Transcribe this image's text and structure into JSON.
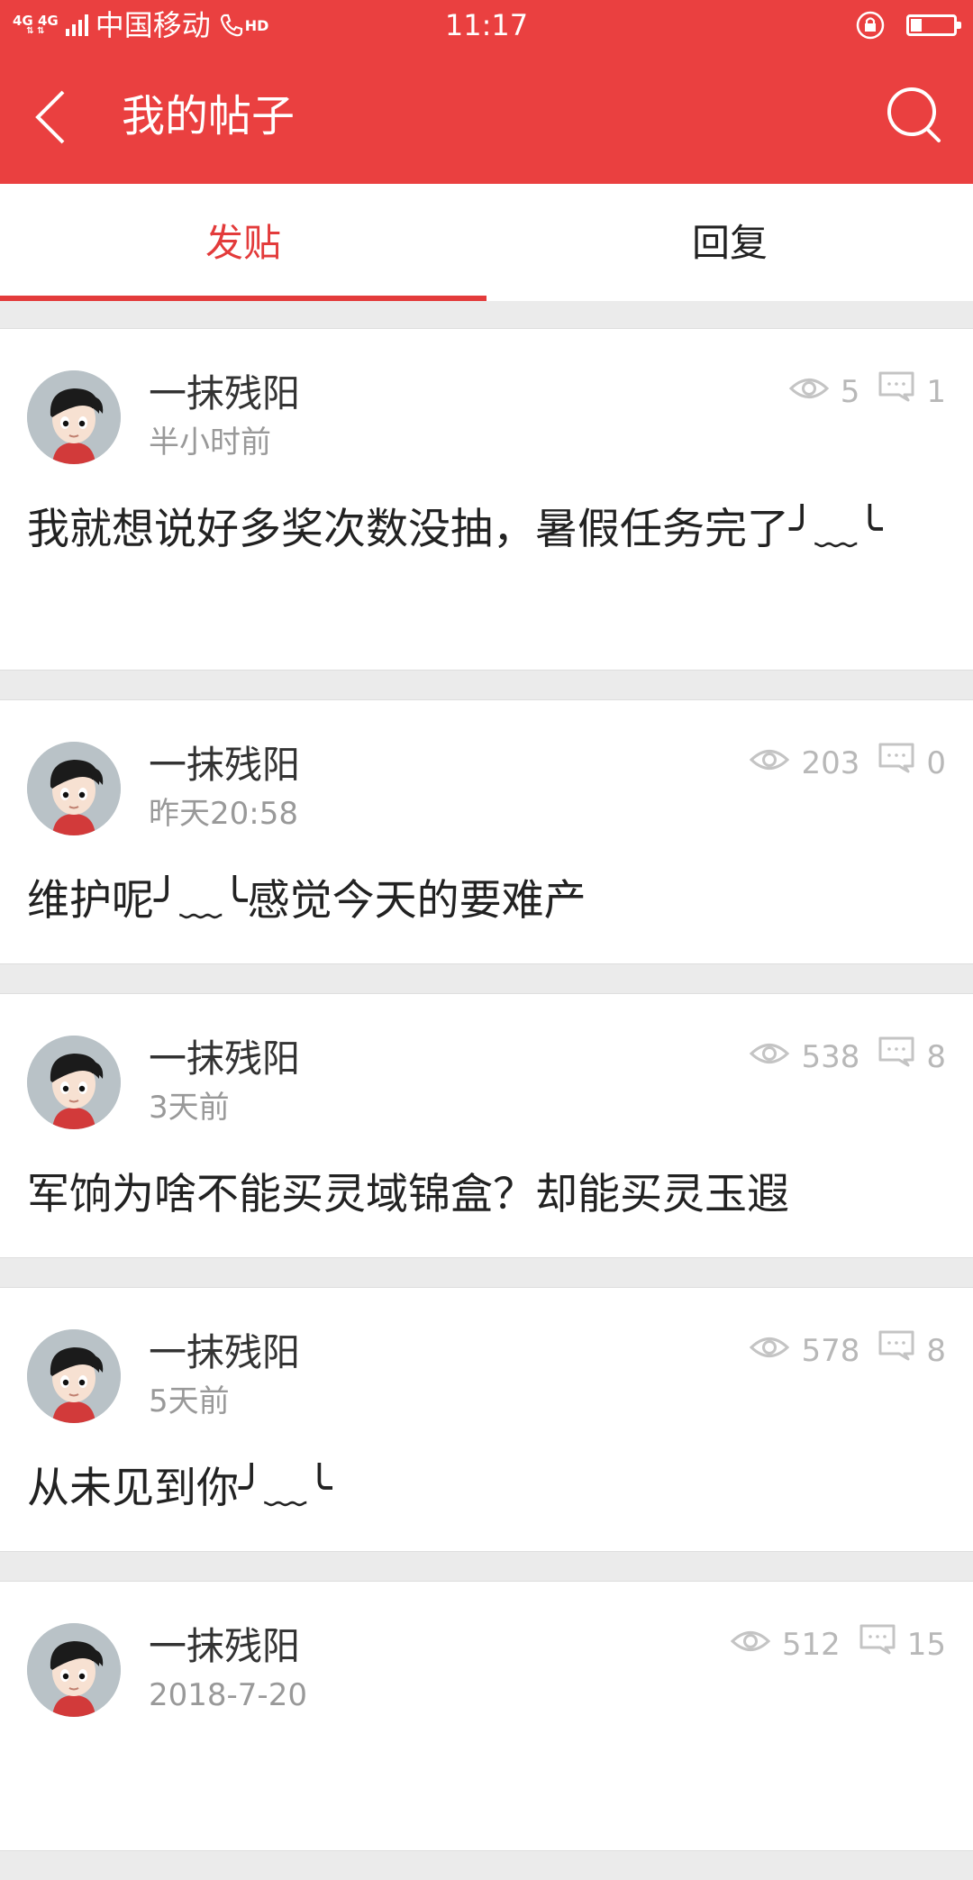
{
  "status_bar": {
    "network": "4G 4G",
    "carrier": "中国移动",
    "hd": "HD",
    "time": "11:17"
  },
  "header": {
    "title": "我的帖子"
  },
  "tabs": {
    "post": "发贴",
    "reply": "回复"
  },
  "posts": [
    {
      "author": "一抹残阳",
      "time": "半小时前",
      "views": "5",
      "comments": "1",
      "content": "我就想说好多奖次数没抽，暑假任务完了╯﹏╰"
    },
    {
      "author": "一抹残阳",
      "time": "昨天20:58",
      "views": "203",
      "comments": "0",
      "content": "维护呢╯﹏╰感觉今天的要难产"
    },
    {
      "author": "一抹残阳",
      "time": "3天前",
      "views": "538",
      "comments": "8",
      "content": "军饷为啥不能买灵域锦盒？却能买灵玉遐"
    },
    {
      "author": "一抹残阳",
      "time": "5天前",
      "views": "578",
      "comments": "8",
      "content": "从未见到你╯﹏╰"
    },
    {
      "author": "一抹残阳",
      "time": "2018-7-20",
      "views": "512",
      "comments": "15",
      "content": ""
    }
  ],
  "colors": {
    "accent": "#ea4040",
    "tab_active": "#e33b3b",
    "meta_gray": "#999999"
  }
}
